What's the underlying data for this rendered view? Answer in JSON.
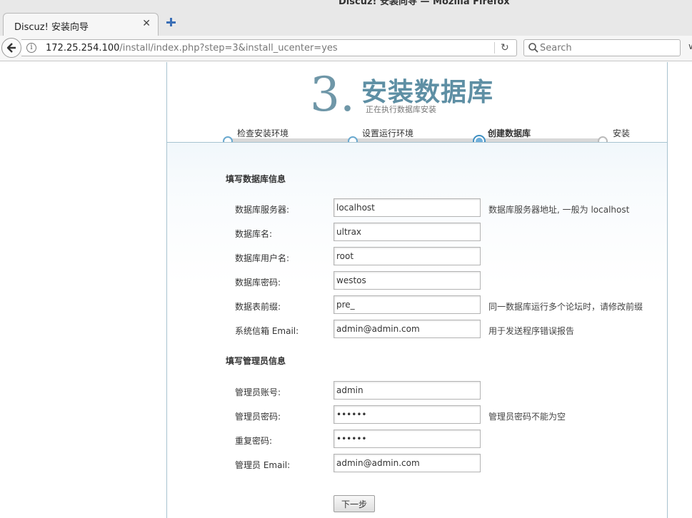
{
  "window": {
    "title": "Discuz! 安装向导 — Mozilla Firefox"
  },
  "tab": {
    "title": "Discuz! 安装向导",
    "close": "✕"
  },
  "navbar": {
    "url_host": "172.25.254.100",
    "url_path": "/install/index.php?step=3&install_ucenter=yes",
    "search_placeholder": "Search"
  },
  "header": {
    "step_number": "3",
    "step_dot": ".",
    "title": "安装数据库",
    "subtitle": "正在执行数据库安装"
  },
  "steps": [
    {
      "label": "检查安装环境",
      "state": "done"
    },
    {
      "label": "设置运行环境",
      "state": "done"
    },
    {
      "label": "创建数据库",
      "state": "active"
    },
    {
      "label": "安装",
      "state": "pending"
    }
  ],
  "db_section": {
    "title": "填写数据库信息",
    "rows": [
      {
        "label": "数据库服务器:",
        "value": "localhost",
        "type": "text",
        "hint": "数据库服务器地址, 一般为 localhost"
      },
      {
        "label": "数据库名:",
        "value": "ultrax",
        "type": "text",
        "hint": ""
      },
      {
        "label": "数据库用户名:",
        "value": "root",
        "type": "text",
        "hint": ""
      },
      {
        "label": "数据库密码:",
        "value": "westos",
        "type": "text",
        "hint": ""
      },
      {
        "label": "数据表前缀:",
        "value": "pre_",
        "type": "text",
        "hint": "同一数据库运行多个论坛时，请修改前缀"
      },
      {
        "label": "系统信箱 Email:",
        "value": "admin@admin.com",
        "type": "text",
        "hint": "用于发送程序错误报告"
      }
    ]
  },
  "admin_section": {
    "title": "填写管理员信息",
    "rows": [
      {
        "label": "管理员账号:",
        "value": "admin",
        "type": "text",
        "hint": ""
      },
      {
        "label": "管理员密码:",
        "value": "admin1",
        "type": "password",
        "hint": "管理员密码不能为空"
      },
      {
        "label": "重复密码:",
        "value": "admin1",
        "type": "password",
        "hint": ""
      },
      {
        "label": "管理员 Email:",
        "value": "admin@admin.com",
        "type": "text",
        "hint": ""
      }
    ]
  },
  "next_button": "下一步"
}
